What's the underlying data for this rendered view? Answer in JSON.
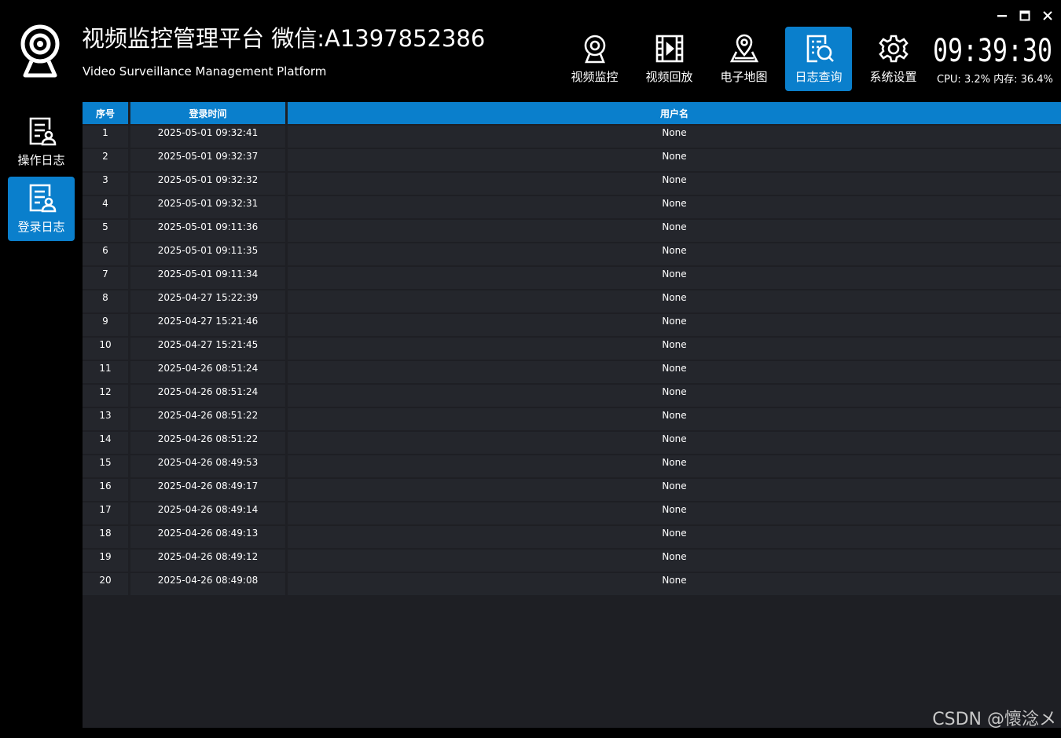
{
  "header": {
    "title": "视频监控管理平台 微信:A1397852386",
    "subtitle": "Video Surveillance Management Platform",
    "logo_icon": "webcam-icon"
  },
  "nav": [
    {
      "label": "视频监控",
      "icon": "webcam-icon",
      "active": false
    },
    {
      "label": "视频回放",
      "icon": "film-icon",
      "active": false
    },
    {
      "label": "电子地图",
      "icon": "map-pin-icon",
      "active": false
    },
    {
      "label": "日志查询",
      "icon": "log-search-icon",
      "active": true
    },
    {
      "label": "系统设置",
      "icon": "gear-icon",
      "active": false
    }
  ],
  "clock": {
    "time": "09:39:30"
  },
  "sysinfo": {
    "text": "CPU: 3.2%  内存: 36.4%"
  },
  "window_controls": {
    "minimize_icon": "minimize-icon",
    "maximize_icon": "maximize-icon",
    "close_icon": "close-icon"
  },
  "sidebar": [
    {
      "label": "操作日志",
      "icon": "log-user-icon",
      "active": false
    },
    {
      "label": "登录日志",
      "icon": "log-user-icon",
      "active": true
    }
  ],
  "table": {
    "columns": [
      "序号",
      "登录时间",
      "用户名"
    ],
    "rows": [
      [
        "1",
        "2025-05-01 09:32:41",
        "None"
      ],
      [
        "2",
        "2025-05-01 09:32:37",
        "None"
      ],
      [
        "3",
        "2025-05-01 09:32:32",
        "None"
      ],
      [
        "4",
        "2025-05-01 09:32:31",
        "None"
      ],
      [
        "5",
        "2025-05-01 09:11:36",
        "None"
      ],
      [
        "6",
        "2025-05-01 09:11:35",
        "None"
      ],
      [
        "7",
        "2025-05-01 09:11:34",
        "None"
      ],
      [
        "8",
        "2025-04-27 15:22:39",
        "None"
      ],
      [
        "9",
        "2025-04-27 15:21:46",
        "None"
      ],
      [
        "10",
        "2025-04-27 15:21:45",
        "None"
      ],
      [
        "11",
        "2025-04-26 08:51:24",
        "None"
      ],
      [
        "12",
        "2025-04-26 08:51:24",
        "None"
      ],
      [
        "13",
        "2025-04-26 08:51:22",
        "None"
      ],
      [
        "14",
        "2025-04-26 08:51:22",
        "None"
      ],
      [
        "15",
        "2025-04-26 08:49:53",
        "None"
      ],
      [
        "16",
        "2025-04-26 08:49:17",
        "None"
      ],
      [
        "17",
        "2025-04-26 08:49:14",
        "None"
      ],
      [
        "18",
        "2025-04-26 08:49:13",
        "None"
      ],
      [
        "19",
        "2025-04-26 08:49:12",
        "None"
      ],
      [
        "20",
        "2025-04-26 08:49:08",
        "None"
      ]
    ]
  },
  "watermark": "CSDN @懷淰メ",
  "colors": {
    "accent": "#0a7fcc",
    "background": "#000000",
    "table_bg": "#1e1f24",
    "row_bg": "#24262c"
  }
}
